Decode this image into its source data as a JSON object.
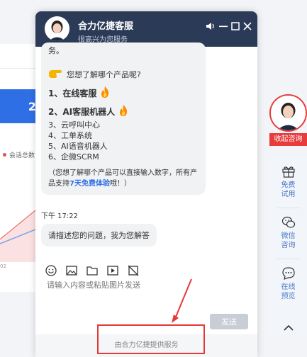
{
  "background": {
    "stat_value": "20",
    "legend_label": "会话总数",
    "axis_tick": "02"
  },
  "header": {
    "title": "合力亿捷客服",
    "subtitle": "很高兴为您服务"
  },
  "bot_message": {
    "tail_text": "务。",
    "question": "您想了解哪个产品呢?",
    "hot_items": [
      "1、在线客服",
      "2、AI客服机器人"
    ],
    "options": [
      "3、云呼叫中心",
      "4、工单系统",
      "5、AI语音机器人",
      "6、企微SCRM"
    ],
    "note_prefix": "（您想了解哪个产品可以直接输入数字，所有产品支持",
    "note_highlight": "7天免费体验",
    "note_suffix": "哦！）"
  },
  "timestamp": "下午 17:22",
  "prompt_message": "请描述您的问题，我为您解答",
  "input": {
    "placeholder": "请输入内容或粘贴图片发送"
  },
  "send_label": "发送",
  "powered_by": "由合力亿捷提供服务",
  "sidebar": {
    "tag": "收起咨询",
    "items": [
      {
        "label": "免费\n试用",
        "icon": "gift-icon"
      },
      {
        "label": "微信\n咨询",
        "icon": "wechat-icon"
      },
      {
        "label": "在线\n预览",
        "icon": "chat-bubble-icon"
      }
    ]
  },
  "colors": {
    "header": "#2b3a57",
    "accent": "#2f6fe6",
    "tag": "#e83b3b",
    "annotation": "#e53935"
  }
}
